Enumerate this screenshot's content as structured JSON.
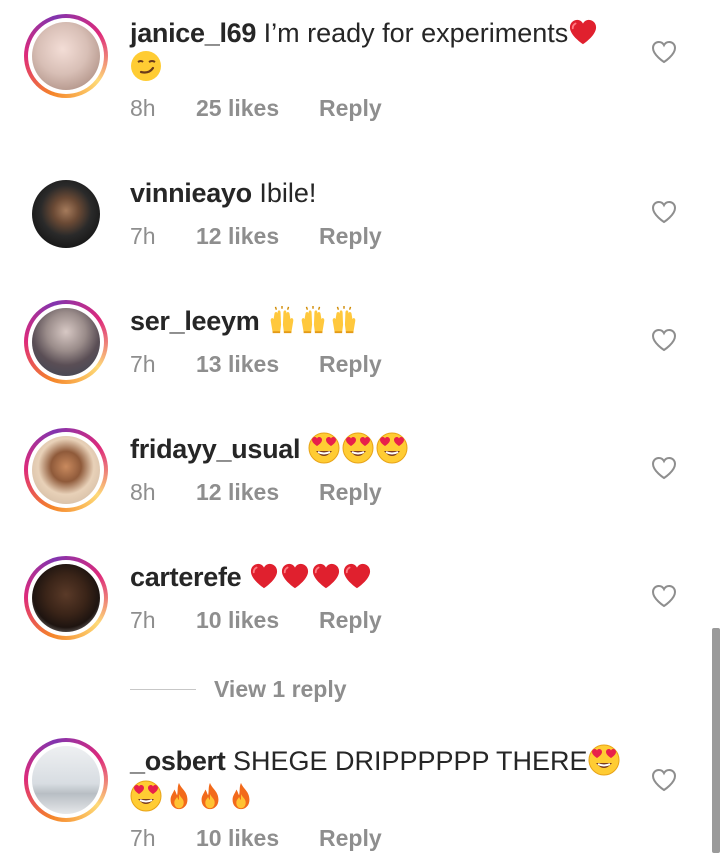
{
  "comments": [
    {
      "username": "janice_l69",
      "text": "I’m ready for experiments",
      "text_emojis": [
        "red-heart"
      ],
      "line2_emojis": [
        "smirk"
      ],
      "time": "8h",
      "likes": "25 likes",
      "reply": "Reply",
      "avatar": "avatar"
    },
    {
      "username": "vinnieayo",
      "text": "Ibile!",
      "time": "7h",
      "likes": "12 likes",
      "reply": "Reply",
      "avatar": "avatar"
    },
    {
      "username": "ser_leeym",
      "text": "",
      "text_emojis": [
        "raising-hands",
        "raising-hands",
        "raising-hands"
      ],
      "time": "7h",
      "likes": "13 likes",
      "reply": "Reply",
      "avatar": "avatar"
    },
    {
      "username": "fridayy_usual",
      "text": "",
      "text_emojis": [
        "heart-eyes",
        "heart-eyes",
        "heart-eyes"
      ],
      "time": "8h",
      "likes": "12 likes",
      "reply": "Reply",
      "avatar": "avatar"
    },
    {
      "username": "carterefe",
      "text": "",
      "text_emojis": [
        "red-heart",
        "red-heart",
        "red-heart",
        "red-heart"
      ],
      "time": "7h",
      "likes": "10 likes",
      "reply": "Reply",
      "avatar": "avatar",
      "view_replies": "View 1 reply"
    },
    {
      "username": "_osbert",
      "text": "SHEGE DRIPPPPPP THERE",
      "text_emojis": [
        "heart-eyes"
      ],
      "line2_emojis": [
        "heart-eyes",
        "fire",
        "fire",
        "fire"
      ],
      "time": "7h",
      "likes": "10 likes",
      "reply": "Reply",
      "avatar": "avatar"
    }
  ],
  "icons": {
    "like": "heart-outline-icon"
  },
  "colors": {
    "ring_start": "#f58529",
    "ring_mid": "#dd2a7b",
    "meta_text": "#8e8e8e",
    "username": "#262626",
    "heart": "#e0202e"
  }
}
